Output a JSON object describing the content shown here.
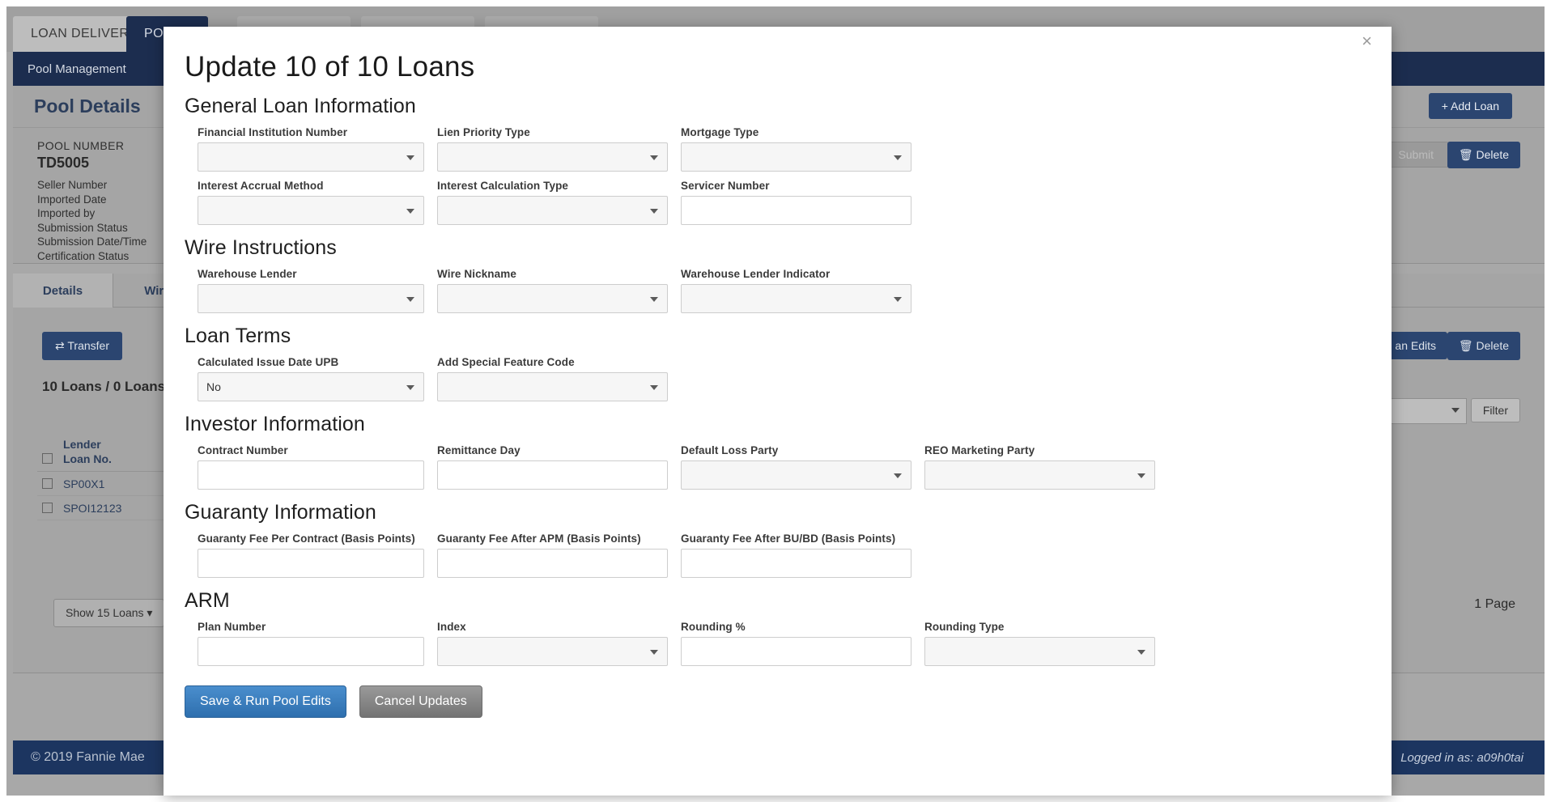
{
  "browser": {
    "tabs": [
      {
        "label": "LOAN DELIVERY",
        "active": false
      },
      {
        "label": "POOLS",
        "active": true
      },
      {
        "label": "",
        "active": false
      },
      {
        "label": "",
        "active": false
      },
      {
        "label": "",
        "active": false
      }
    ]
  },
  "subnav": {
    "item": "Pool Management"
  },
  "page": {
    "title": "Pool Details",
    "add_loan_label": "+ Add Loan",
    "submit_label": "Submit",
    "delete_label": "Delete"
  },
  "pool_info": {
    "pool_number_label": "POOL NUMBER",
    "pool_number_value": "TD5005",
    "meta": [
      "Seller Number",
      "Imported Date",
      "Imported by",
      "Submission Status",
      "Submission Date/Time",
      "Certification Status"
    ]
  },
  "subtabs": [
    {
      "label": "Details",
      "active": true
    },
    {
      "label": "Wiring",
      "active": false
    }
  ],
  "loan_panel": {
    "transfer_label": "Transfer",
    "loan_count": "10 Loans / 0 Loans",
    "loan_edits_label": "an Edits",
    "delete_label": "Delete",
    "filter_label": "Filter",
    "show_loans_label": "Show 15 Loans",
    "page_indicator": "1 Page",
    "table": {
      "header_line1": "Lender",
      "header_line2": "Loan No.",
      "rows": [
        "SP00X1",
        "SPOI12123"
      ]
    }
  },
  "footer": {
    "copyright": "© 2019 Fannie Mae",
    "logged_in": "Logged in as: a09h0tai"
  },
  "modal": {
    "title": "Update 10 of 10 Loans",
    "close_label": "×",
    "save_label": "Save & Run Pool Edits",
    "cancel_label": "Cancel Updates",
    "sections": [
      {
        "title": "General Loan Information",
        "rows": [
          [
            {
              "label": "Financial Institution Number",
              "type": "select",
              "value": "",
              "width": "w280"
            },
            {
              "label": "Lien Priority Type",
              "type": "select",
              "value": "",
              "width": "w285"
            },
            {
              "label": "Mortgage Type",
              "type": "select",
              "value": "",
              "width": "w285"
            }
          ],
          [
            {
              "label": "Interest Accrual Method",
              "type": "select",
              "value": "",
              "width": "w280"
            },
            {
              "label": "Interest Calculation Type",
              "type": "select",
              "value": "",
              "width": "w285"
            },
            {
              "label": "Servicer Number",
              "type": "input",
              "value": "",
              "width": "w285"
            }
          ]
        ]
      },
      {
        "title": "Wire Instructions",
        "rows": [
          [
            {
              "label": "Warehouse Lender",
              "type": "select",
              "value": "",
              "width": "w280"
            },
            {
              "label": "Wire Nickname",
              "type": "select",
              "value": "",
              "width": "w285"
            },
            {
              "label": "Warehouse Lender Indicator",
              "type": "select",
              "value": "",
              "width": "w285"
            }
          ]
        ]
      },
      {
        "title": "Loan Terms",
        "rows": [
          [
            {
              "label": "Calculated Issue Date UPB",
              "type": "select",
              "value": "No",
              "width": "w280"
            },
            {
              "label": "Add Special Feature Code",
              "type": "select",
              "value": "",
              "width": "w285"
            }
          ]
        ]
      },
      {
        "title": "Investor Information",
        "rows": [
          [
            {
              "label": "Contract Number",
              "type": "input",
              "value": "",
              "width": "w280"
            },
            {
              "label": "Remittance Day",
              "type": "input",
              "value": "",
              "width": "w285"
            },
            {
              "label": "Default Loss Party",
              "type": "select",
              "value": "",
              "width": "w285"
            },
            {
              "label": "REO Marketing Party",
              "type": "select",
              "value": "",
              "width": "w285"
            }
          ]
        ]
      },
      {
        "title": "Guaranty Information",
        "rows": [
          [
            {
              "label": "Guaranty Fee Per Contract (Basis Points)",
              "type": "input",
              "value": "",
              "width": "w280"
            },
            {
              "label": "Guaranty Fee After APM (Basis Points)",
              "type": "input",
              "value": "",
              "width": "w285"
            },
            {
              "label": "Guaranty Fee After BU/BD (Basis Points)",
              "type": "input",
              "value": "",
              "width": "w285"
            }
          ]
        ]
      },
      {
        "title": "ARM",
        "rows": [
          [
            {
              "label": "Plan Number",
              "type": "input",
              "value": "",
              "width": "w280"
            },
            {
              "label": "Index",
              "type": "select",
              "value": "",
              "width": "w285"
            },
            {
              "label": "Rounding %",
              "type": "input",
              "value": "",
              "width": "w285"
            },
            {
              "label": "Rounding Type",
              "type": "select",
              "value": "",
              "width": "w285"
            }
          ]
        ]
      }
    ]
  },
  "colors": {
    "navy": "#1c2d4f",
    "primary_blue": "#3a7cbf",
    "button_navy": "#2b4570",
    "link_navy": "#2c3e5c"
  }
}
